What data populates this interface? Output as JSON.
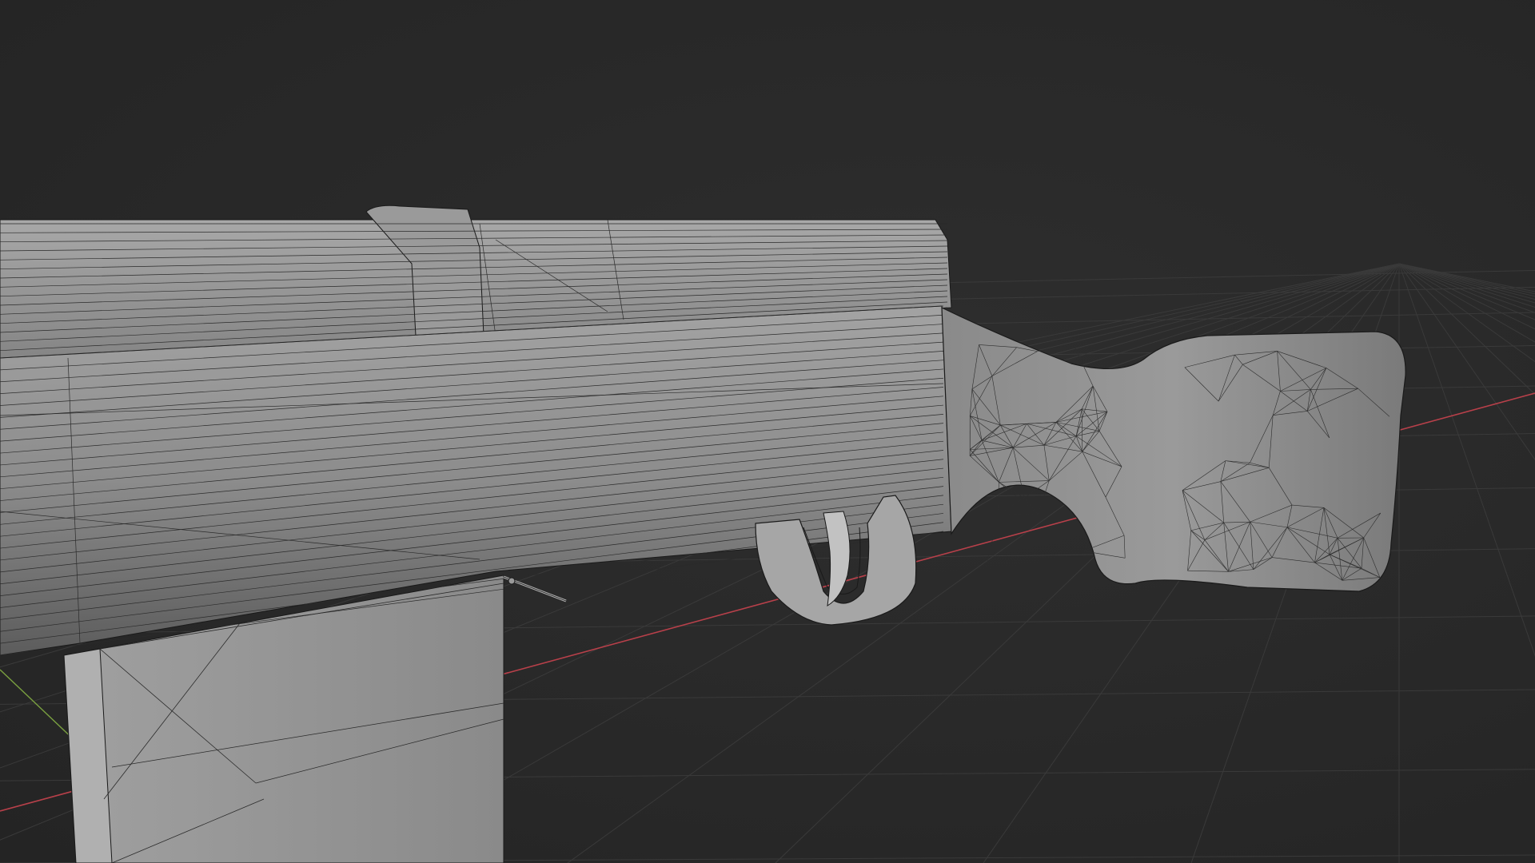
{
  "app": {
    "name": "3D viewport",
    "view_mode": "solid-wireframe-overlay"
  },
  "scene": {
    "object": "rifle-model",
    "parts": [
      "receiver",
      "top-cover",
      "stock",
      "trigger-guard",
      "trigger",
      "magazine",
      "bolt-handle"
    ],
    "grid_floor": true,
    "axes_visible": [
      "x-axis",
      "y-axis"
    ]
  },
  "colors": {
    "background": "#2a2a2a",
    "grid_line": "#3a3a3a",
    "x_axis": "#b8404a",
    "y_axis": "#7aa040",
    "mesh_fill": "#8e8e8e",
    "mesh_wire": "#1a1a1a"
  }
}
